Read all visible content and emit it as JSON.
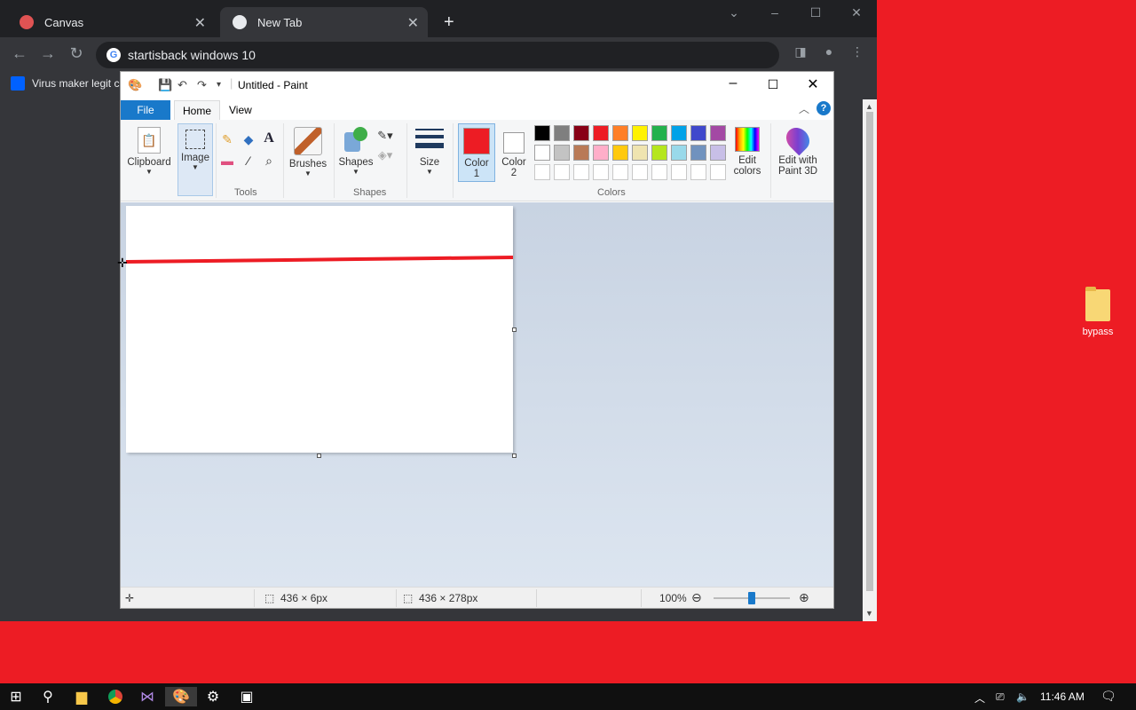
{
  "browser": {
    "tabs": [
      {
        "label": "Canvas",
        "active": false
      },
      {
        "label": "New Tab",
        "active": true
      }
    ],
    "address": "startisback windows 10",
    "bookmark": "Virus maker legit c"
  },
  "paint": {
    "title": "Untitled - Paint",
    "tabs": {
      "file": "File",
      "home": "Home",
      "view": "View"
    },
    "help": "?",
    "ribbon": {
      "clipboard": "Clipboard",
      "image": "Image",
      "tools_group": "Tools",
      "brushes": "Brushes",
      "shapes": "Shapes",
      "shapes_group": "Shapes",
      "size": "Size",
      "color1": "Color\n1",
      "color1_a": "Color",
      "color1_b": "1",
      "color2_a": "Color",
      "color2_b": "2",
      "edit_colors_a": "Edit",
      "edit_colors_b": "colors",
      "paint3d_a": "Edit with",
      "paint3d_b": "Paint 3D",
      "colors_group": "Colors"
    },
    "colors": {
      "color1": "#ed1c24",
      "color2": "#ffffff",
      "palette_row1": [
        "#000000",
        "#7f7f7f",
        "#880015",
        "#ed1c24",
        "#ff7f27",
        "#fff200",
        "#22b14c",
        "#00a2e8",
        "#3f48cc",
        "#a349a4"
      ],
      "palette_row2": [
        "#ffffff",
        "#c3c3c3",
        "#b97a57",
        "#ffaec9",
        "#ffc90e",
        "#efe4b0",
        "#b5e61d",
        "#99d9ea",
        "#7092be",
        "#c8bfe7"
      ]
    },
    "status": {
      "selection_size": "436 × 6px",
      "canvas_size": "436 × 278px",
      "zoom": "100%",
      "zoom_level": 0.5
    }
  },
  "desktop": {
    "icon_label": "bypass"
  },
  "taskbar": {
    "time": "11:46 AM"
  }
}
